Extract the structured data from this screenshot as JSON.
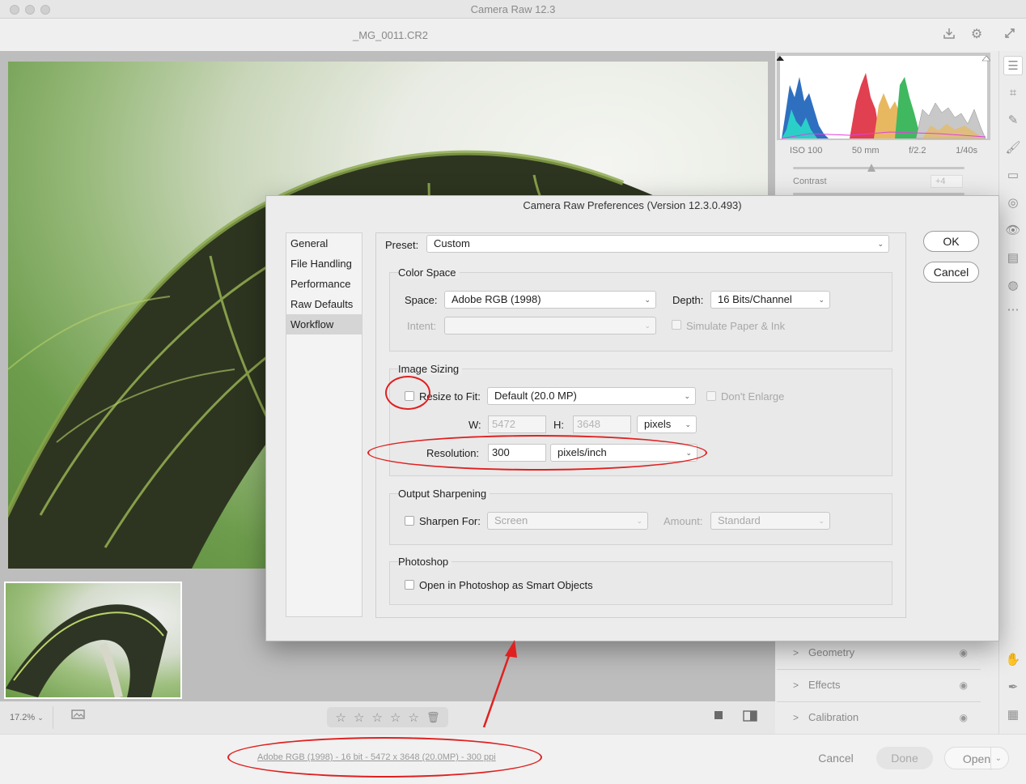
{
  "window": {
    "title": "Camera Raw 12.3",
    "filename": "_MG_0011.CR2"
  },
  "histogram": {
    "camera_info": [
      "ISO 100",
      "50 mm",
      "f/2.2",
      "1/40s"
    ],
    "contrast_label": "Contrast",
    "contrast_value": "+4"
  },
  "panels": [
    {
      "label": "Geometry",
      "chevron": "chevron-right-icon",
      "eye": "eye-icon"
    },
    {
      "label": "Effects",
      "chevron": "chevron-right-icon",
      "eye": "eye-icon"
    },
    {
      "label": "Calibration",
      "chevron": "chevron-right-icon",
      "eye": "eye-icon"
    }
  ],
  "zoom": "17.2%",
  "rating_stars": [
    "☆",
    "☆",
    "☆",
    "☆",
    "☆"
  ],
  "bottom": {
    "workflow_link": "Adobe RGB (1998) - 16 bit - 5472 x 3648 (20.0MP) - 300 ppi",
    "cancel": "Cancel",
    "done": "Done",
    "open": "Open"
  },
  "dialog": {
    "title": "Camera Raw Preferences  (Version 12.3.0.493)",
    "nav": [
      "General",
      "File Handling",
      "Performance",
      "Raw Defaults",
      "Workflow"
    ],
    "nav_active": "Workflow",
    "preset_label": "Preset:",
    "preset_value": "Custom",
    "ok": "OK",
    "cancel": "Cancel",
    "color_space": {
      "title": "Color Space",
      "space_label": "Space:",
      "space_value": "Adobe RGB (1998)",
      "depth_label": "Depth:",
      "depth_value": "16 Bits/Channel",
      "intent_label": "Intent:",
      "intent_value": "",
      "simulate_label": "Simulate Paper & Ink"
    },
    "image_sizing": {
      "title": "Image Sizing",
      "resize_label": "Resize to Fit:",
      "resize_value": "Default  (20.0 MP)",
      "dont_enlarge_label": "Don't Enlarge",
      "w_label": "W:",
      "w_value": "5472",
      "h_label": "H:",
      "h_value": "3648",
      "units_value": "pixels",
      "resolution_label": "Resolution:",
      "resolution_value": "300",
      "resolution_units": "pixels/inch"
    },
    "output_sharpening": {
      "title": "Output Sharpening",
      "sharpen_label": "Sharpen For:",
      "sharpen_value": "Screen",
      "amount_label": "Amount:",
      "amount_value": "Standard"
    },
    "photoshop": {
      "title": "Photoshop",
      "smart_objects_label": "Open in Photoshop as Smart Objects"
    }
  },
  "colors": {
    "annotation": "#e02020",
    "accent_active": "#d5d5d5"
  }
}
